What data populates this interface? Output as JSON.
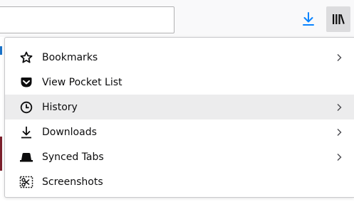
{
  "toolbar": {
    "url_value": "",
    "download_icon": "download-arrow-icon",
    "library_icon": "library-icon",
    "accent_color": "#0a84ff"
  },
  "menu": {
    "items": [
      {
        "id": "bookmarks",
        "label": "Bookmarks",
        "icon": "star-icon",
        "has_submenu": true,
        "highlighted": false
      },
      {
        "id": "pocket",
        "label": "View Pocket List",
        "icon": "pocket-icon",
        "has_submenu": false,
        "highlighted": false
      },
      {
        "id": "history",
        "label": "History",
        "icon": "clock-icon",
        "has_submenu": true,
        "highlighted": true
      },
      {
        "id": "downloads",
        "label": "Downloads",
        "icon": "download-icon",
        "has_submenu": true,
        "highlighted": false
      },
      {
        "id": "synced",
        "label": "Synced Tabs",
        "icon": "synced-tabs-icon",
        "has_submenu": true,
        "highlighted": false
      },
      {
        "id": "screenshots",
        "label": "Screenshots",
        "icon": "screenshots-icon",
        "has_submenu": false,
        "highlighted": false
      }
    ]
  }
}
